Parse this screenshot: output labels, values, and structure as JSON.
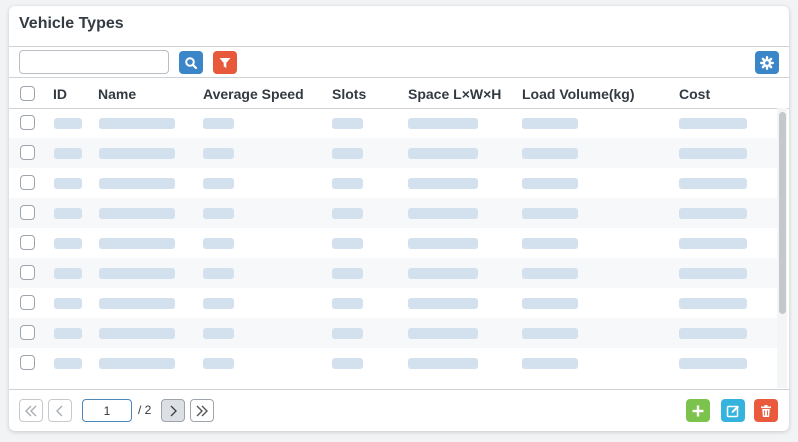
{
  "panel": {
    "title": "Vehicle Types"
  },
  "toolbar": {
    "search_value": "",
    "search_placeholder": ""
  },
  "table": {
    "columns": [
      "ID",
      "Name",
      "Average Speed",
      "Slots",
      "Space L×W×H",
      "Load Volume(kg)",
      "Cost"
    ],
    "row_count": 9
  },
  "pagination": {
    "current_page": "1",
    "total_label": "/ 2"
  },
  "colors": {
    "primary": "#3a86c8",
    "filter": "#e8583a",
    "add": "#7cc34d",
    "edit": "#33b3dd",
    "delete": "#ea5a3d",
    "placeholder": "#d3e0ed"
  },
  "icons": {
    "search": "search-icon",
    "filter": "filter-icon",
    "settings": "gear-icon",
    "first": "double-chevron-left-icon",
    "prev": "chevron-left-icon",
    "next": "chevron-right-icon",
    "last": "double-chevron-right-icon",
    "add": "plus-icon",
    "edit": "edit-icon",
    "delete": "trash-icon"
  }
}
